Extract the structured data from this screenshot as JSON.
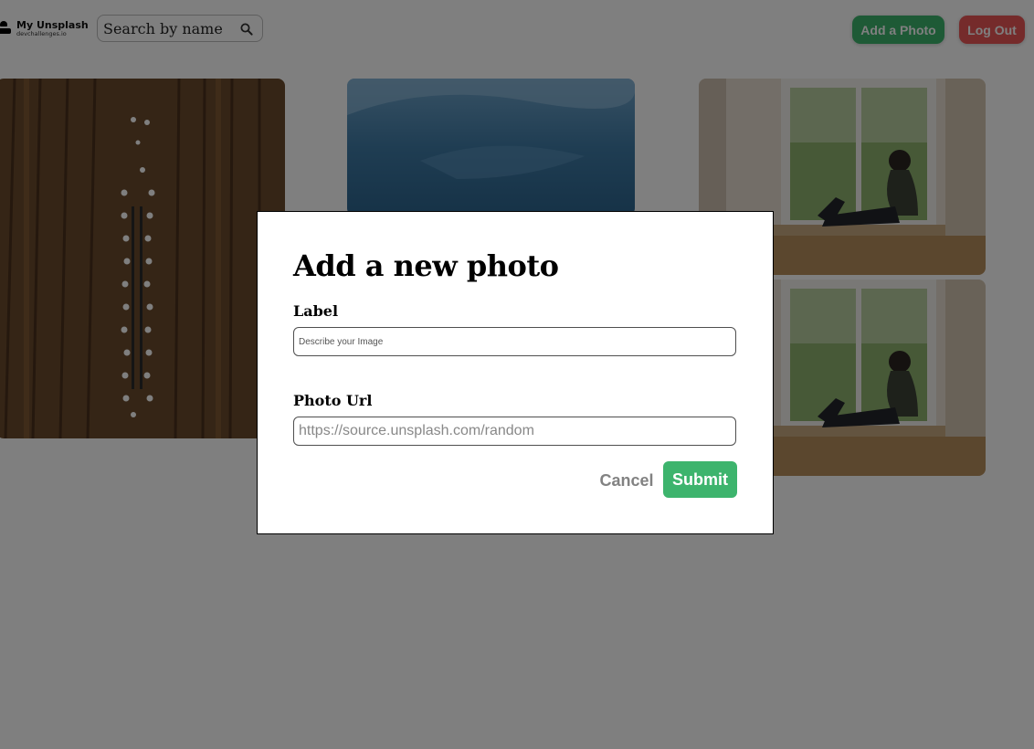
{
  "header": {
    "logo": {
      "title": "My Unsplash",
      "subtitle": "devchallenges.io"
    },
    "search": {
      "placeholder": "Search by name"
    },
    "add_photo_label": "Add a Photo",
    "logout_label": "Log Out"
  },
  "colors": {
    "accent_green": "#3db46d",
    "danger_red": "#eb5757",
    "overlay": "rgba(0,0,0,0.5)"
  },
  "modal": {
    "title": "Add a new photo",
    "label_field": {
      "label": "Label",
      "placeholder": "Describe your Image",
      "value": ""
    },
    "url_field": {
      "label": "Photo Url",
      "placeholder": "https://source.unsplash.com/random",
      "value": ""
    },
    "cancel_label": "Cancel",
    "submit_label": "Submit"
  }
}
